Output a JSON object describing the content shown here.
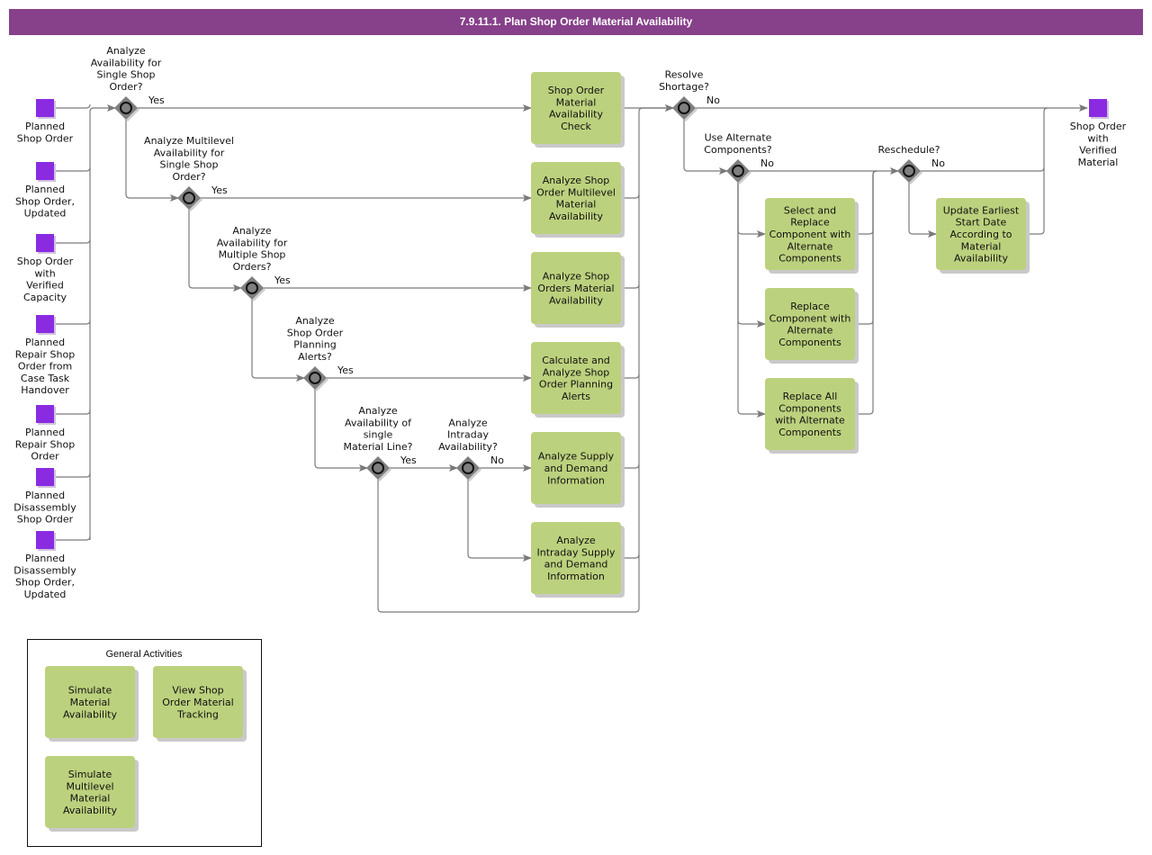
{
  "title": "7.9.11.1. Plan Shop Order Material Availability",
  "colors": {
    "header": "#87408a",
    "activity": "#bcd17d",
    "event": "#8a2be2",
    "gateway": "#7f7f7f",
    "connector": "#7a7a7a"
  },
  "start_events": [
    {
      "id": "ev1",
      "label": [
        "Planned",
        "Shop Order"
      ]
    },
    {
      "id": "ev2",
      "label": [
        "Planned",
        "Shop Order,",
        "Updated"
      ]
    },
    {
      "id": "ev3",
      "label": [
        "Shop Order",
        "with",
        "Verified",
        "Capacity"
      ]
    },
    {
      "id": "ev4",
      "label": [
        "Planned",
        "Repair Shop",
        "Order from",
        "Case Task",
        "Handover"
      ]
    },
    {
      "id": "ev5",
      "label": [
        "Planned",
        "Repair Shop",
        "Order"
      ]
    },
    {
      "id": "ev6",
      "label": [
        "Planned",
        "Disassembly",
        "Shop Order"
      ]
    },
    {
      "id": "ev7",
      "label": [
        "Planned",
        "Disassembly",
        "Shop Order,",
        "Updated"
      ]
    }
  ],
  "end_event": {
    "id": "end",
    "label": [
      "Shop Order",
      "with",
      "Verified",
      "Material"
    ]
  },
  "gateways": [
    {
      "id": "g1",
      "label": [
        "Analyze",
        "Availability for",
        "Single Shop",
        "Order?"
      ],
      "branch": "Yes"
    },
    {
      "id": "g2",
      "label": [
        "Analyze Multilevel",
        "Availability for",
        "Single Shop",
        "Order?"
      ],
      "branch": "Yes"
    },
    {
      "id": "g3",
      "label": [
        "Analyze",
        "Availability for",
        "Multiple Shop",
        "Orders?"
      ],
      "branch": "Yes"
    },
    {
      "id": "g4",
      "label": [
        "Analyze",
        "Shop Order",
        "Planning",
        "Alerts?"
      ],
      "branch": "Yes"
    },
    {
      "id": "g5",
      "label": [
        "Analyze",
        "Availability of",
        "single",
        "Material Line?"
      ],
      "branch": "Yes"
    },
    {
      "id": "g6",
      "label": [
        "Analyze",
        "Intraday",
        "Availability?"
      ],
      "branch": "No"
    },
    {
      "id": "g7",
      "label": [
        "Resolve",
        "Shortage?"
      ],
      "branch": "No"
    },
    {
      "id": "g8",
      "label": [
        "Use Alternate",
        "Components?"
      ],
      "branch": "No"
    },
    {
      "id": "g9",
      "label": [
        "Reschedule?"
      ],
      "branch": "No"
    }
  ],
  "activities": [
    {
      "id": "a1",
      "label": [
        "Shop Order",
        "Material",
        "Availability",
        "Check"
      ]
    },
    {
      "id": "a2",
      "label": [
        "Analyze Shop",
        "Order Multilevel",
        "Material",
        "Availability"
      ]
    },
    {
      "id": "a3",
      "label": [
        "Analyze Shop",
        "Orders Material",
        "Availability"
      ]
    },
    {
      "id": "a4",
      "label": [
        "Calculate and",
        "Analyze Shop",
        "Order Planning",
        "Alerts"
      ]
    },
    {
      "id": "a5",
      "label": [
        "Analyze Supply",
        "and Demand",
        "Information"
      ]
    },
    {
      "id": "a6",
      "label": [
        "Analyze",
        "Intraday Supply",
        "and Demand",
        "Information"
      ]
    },
    {
      "id": "a7",
      "label": [
        "Select and",
        "Replace",
        "Component with",
        "Alternate",
        "Components"
      ]
    },
    {
      "id": "a8",
      "label": [
        "Replace",
        "Component with",
        "Alternate",
        "Components"
      ]
    },
    {
      "id": "a9",
      "label": [
        "Replace All",
        "Components",
        "with Alternate",
        "Components"
      ]
    },
    {
      "id": "a10",
      "label": [
        "Update Earliest",
        "Start Date",
        "According to",
        "Material",
        "Availability"
      ]
    }
  ],
  "general_activities": {
    "title": "General Activities",
    "items": [
      {
        "id": "ga1",
        "label": [
          "Simulate",
          "Material",
          "Availability"
        ]
      },
      {
        "id": "ga2",
        "label": [
          "View Shop",
          "Order Material",
          "Tracking"
        ]
      },
      {
        "id": "ga3",
        "label": [
          "Simulate",
          "Multilevel",
          "Material",
          "Availability"
        ]
      }
    ]
  }
}
